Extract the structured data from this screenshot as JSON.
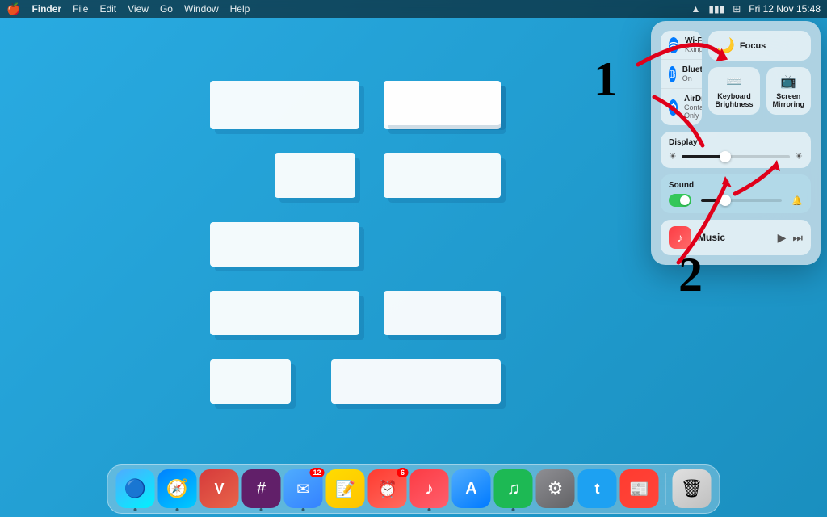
{
  "menubar": {
    "apple": "🍎",
    "app_name": "Finder",
    "menus": [
      "File",
      "Edit",
      "View",
      "Go",
      "Window",
      "Help"
    ],
    "right_icons": [
      "wifi",
      "battery",
      "control-center"
    ],
    "datetime": "Fri 12 Nov  15:48"
  },
  "control_center": {
    "wifi": {
      "label": "Wi-Fi",
      "sublabel": "KxingDom",
      "icon": "📶"
    },
    "bluetooth": {
      "label": "Bluetooth",
      "sublabel": "On",
      "icon": "🔵"
    },
    "airdrop": {
      "label": "AirDrop",
      "sublabel": "Contacts Only",
      "icon": "📡"
    },
    "focus": {
      "label": "Focus",
      "icon": "🌙"
    },
    "keyboard_brightness": {
      "label": "Keyboard Brightness",
      "icon": "⌨"
    },
    "screen_mirroring": {
      "label": "Screen Mirroring",
      "icon": "📺"
    },
    "display": {
      "label": "Display",
      "brightness": 40
    },
    "sound": {
      "label": "Sound",
      "volume": 30,
      "enabled": true
    },
    "music": {
      "label": "Music",
      "icon": "🎵",
      "play_icon": "▶",
      "forward_icon": "⏭"
    }
  },
  "annotations": {
    "number1": "1",
    "number2": "2"
  },
  "dock": {
    "items": [
      {
        "name": "Finder",
        "emoji": "🔵",
        "class": "finder-icon",
        "active": true
      },
      {
        "name": "Safari",
        "emoji": "🧭",
        "class": "safari-icon",
        "active": true
      },
      {
        "name": "Vivaldi",
        "emoji": "V",
        "class": "vivaldi-icon",
        "active": false
      },
      {
        "name": "Slack",
        "emoji": "#",
        "class": "slack-icon",
        "active": true
      },
      {
        "name": "Mail",
        "emoji": "✉",
        "class": "mail-icon",
        "badge": "12",
        "active": true
      },
      {
        "name": "Notes",
        "emoji": "📝",
        "class": "notes-icon",
        "active": false
      },
      {
        "name": "Reminders",
        "emoji": "⏰",
        "class": "reminders-icon",
        "badge": "6",
        "active": false
      },
      {
        "name": "Music",
        "emoji": "♪",
        "class": "music-app-icon",
        "active": true
      },
      {
        "name": "App Store",
        "emoji": "A",
        "class": "appstore-icon",
        "active": false
      },
      {
        "name": "Spotify",
        "emoji": "♫",
        "class": "spotify-icon",
        "active": true
      },
      {
        "name": "System Preferences",
        "emoji": "⚙",
        "class": "settings-icon",
        "active": false
      },
      {
        "name": "Twitter",
        "emoji": "t",
        "class": "twitter-icon",
        "active": false
      },
      {
        "name": "News",
        "emoji": "📰",
        "class": "news-icon",
        "active": false
      },
      {
        "name": "Trash",
        "emoji": "🗑",
        "class": "trash-icon",
        "active": false
      }
    ]
  }
}
